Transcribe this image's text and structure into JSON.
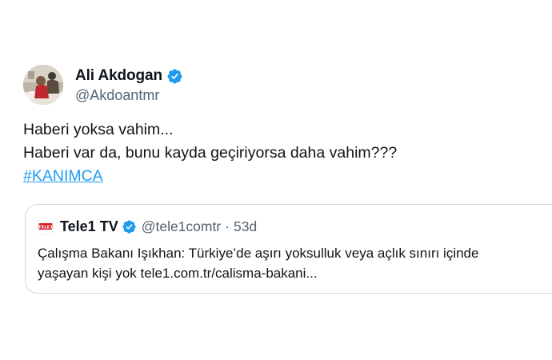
{
  "author": {
    "display_name": "Ali Akdogan",
    "handle": "@Akdoantmr",
    "verified": true,
    "avatar_icon": "profile-photo"
  },
  "tweet": {
    "lines": [
      "Haberi yoksa vahim...",
      "Haberi var da, bunu kayda geçiriyorsa daha vahim???"
    ],
    "hashtag": "#KANIMCA"
  },
  "quoted_tweet": {
    "display_name": "Tele1 TV",
    "handle": "@tele1comtr",
    "separator": "·",
    "time": "53d",
    "verified": true,
    "avatar_icon": "tele1-logo",
    "avatar_text": "TELE1",
    "body_lines": [
      "Çalışma Bakanı Işıkhan: Türkiye’de aşırı yoksulluk veya açlık sınırı içinde",
      "yaşayan kişi yok  tele1.com.tr/calisma-bakani..."
    ]
  },
  "colors": {
    "text": "#0f1419",
    "secondary": "#536471",
    "link": "#1d9bf0",
    "border": "#cfd9de",
    "verified": "#1d9bf0",
    "tele1_red": "#d71920"
  }
}
